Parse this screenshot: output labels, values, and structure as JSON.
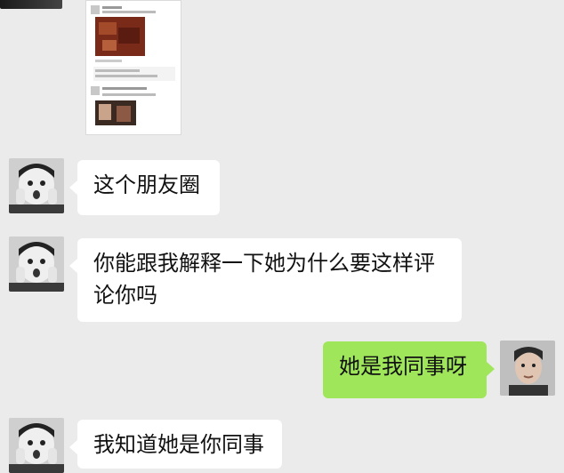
{
  "messages": [
    {
      "side": "left",
      "text": "这个朋友圈"
    },
    {
      "side": "left",
      "text": "你能跟我解释一下她为什么要这样评论你吗"
    },
    {
      "side": "right",
      "text": "她是我同事呀"
    },
    {
      "side": "left",
      "text": "我知道她是你同事"
    }
  ],
  "colors": {
    "background": "#ebebeb",
    "left_bubble": "#ffffff",
    "right_bubble": "#9fe65b"
  }
}
